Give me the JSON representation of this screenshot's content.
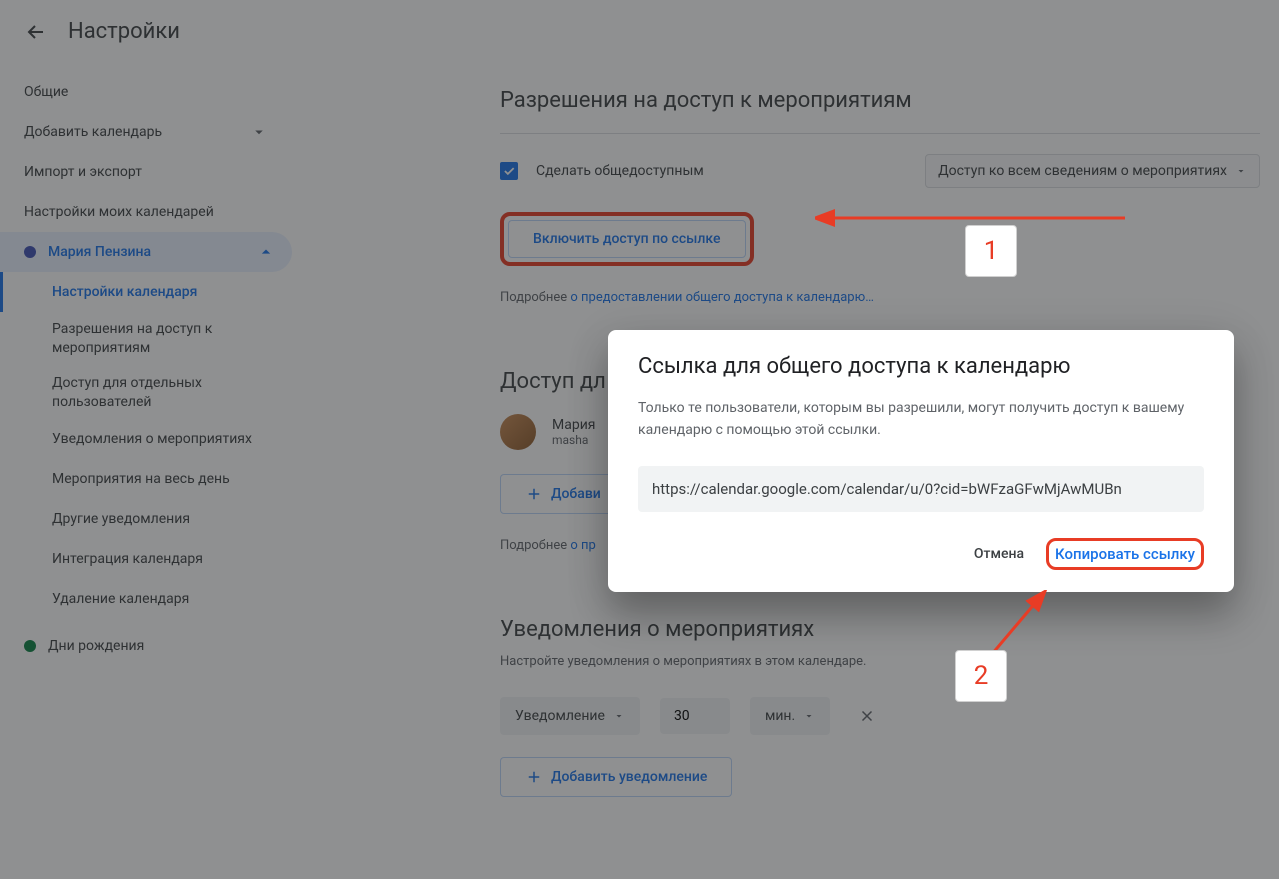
{
  "header": {
    "title": "Настройки"
  },
  "sidebar": {
    "general": "Общие",
    "add_calendar": "Добавить календарь",
    "import_export": "Импорт и экспорт",
    "my_calendars_title": "Настройки моих календарей",
    "active_calendar": "Мария Пензина",
    "birthdays": "Дни рождения",
    "subitems": [
      "Настройки календаря",
      "Разрешения на доступ к мероприятиям",
      "Доступ для отдельных пользователей",
      "Уведомления о мероприятиях",
      "Мероприятия на весь день",
      "Другие уведомления",
      "Интеграция календаря",
      "Удаление календаря"
    ]
  },
  "main": {
    "permissions_title": "Разрешения на доступ к мероприятиям",
    "make_public_label": "Сделать общедоступным",
    "access_dropdown": "Доступ ко всем сведениям о мероприятиях",
    "enable_link_btn": "Включить доступ по ссылке",
    "hint_prefix": "Подробнее ",
    "hint_link": "о предоставлении общего доступа к календарю…",
    "share_title_partial": "Доступ дл",
    "user_name": "Мария",
    "user_email": "masha",
    "add_btn_partial": "Добави",
    "hint2_prefix": "Подробнее ",
    "hint2_link_partial": "о пр",
    "notif_title": "Уведомления о мероприятиях",
    "notif_desc": "Настройте уведомления о мероприятиях в этом календаре.",
    "notif_type": "Уведомление",
    "notif_value": "30",
    "notif_unit": "мин.",
    "add_notif_btn": "Добавить уведомление"
  },
  "modal": {
    "title": "Ссылка для общего доступа к календарю",
    "desc": "Только те пользователи, которым вы разрешили, могут получить доступ к вашему календарю с помощью этой ссылки.",
    "url": "https://calendar.google.com/calendar/u/0?cid=bWFzaGFwMjAwMUBn",
    "cancel": "Отмена",
    "copy": "Копировать ссылку"
  },
  "annotations": {
    "one": "1",
    "two": "2"
  },
  "colors": {
    "primary": "#1a73e8",
    "accent_red": "#e83c25",
    "calendar_dot": "#3f51b5",
    "birthday_dot": "#0b8043"
  }
}
